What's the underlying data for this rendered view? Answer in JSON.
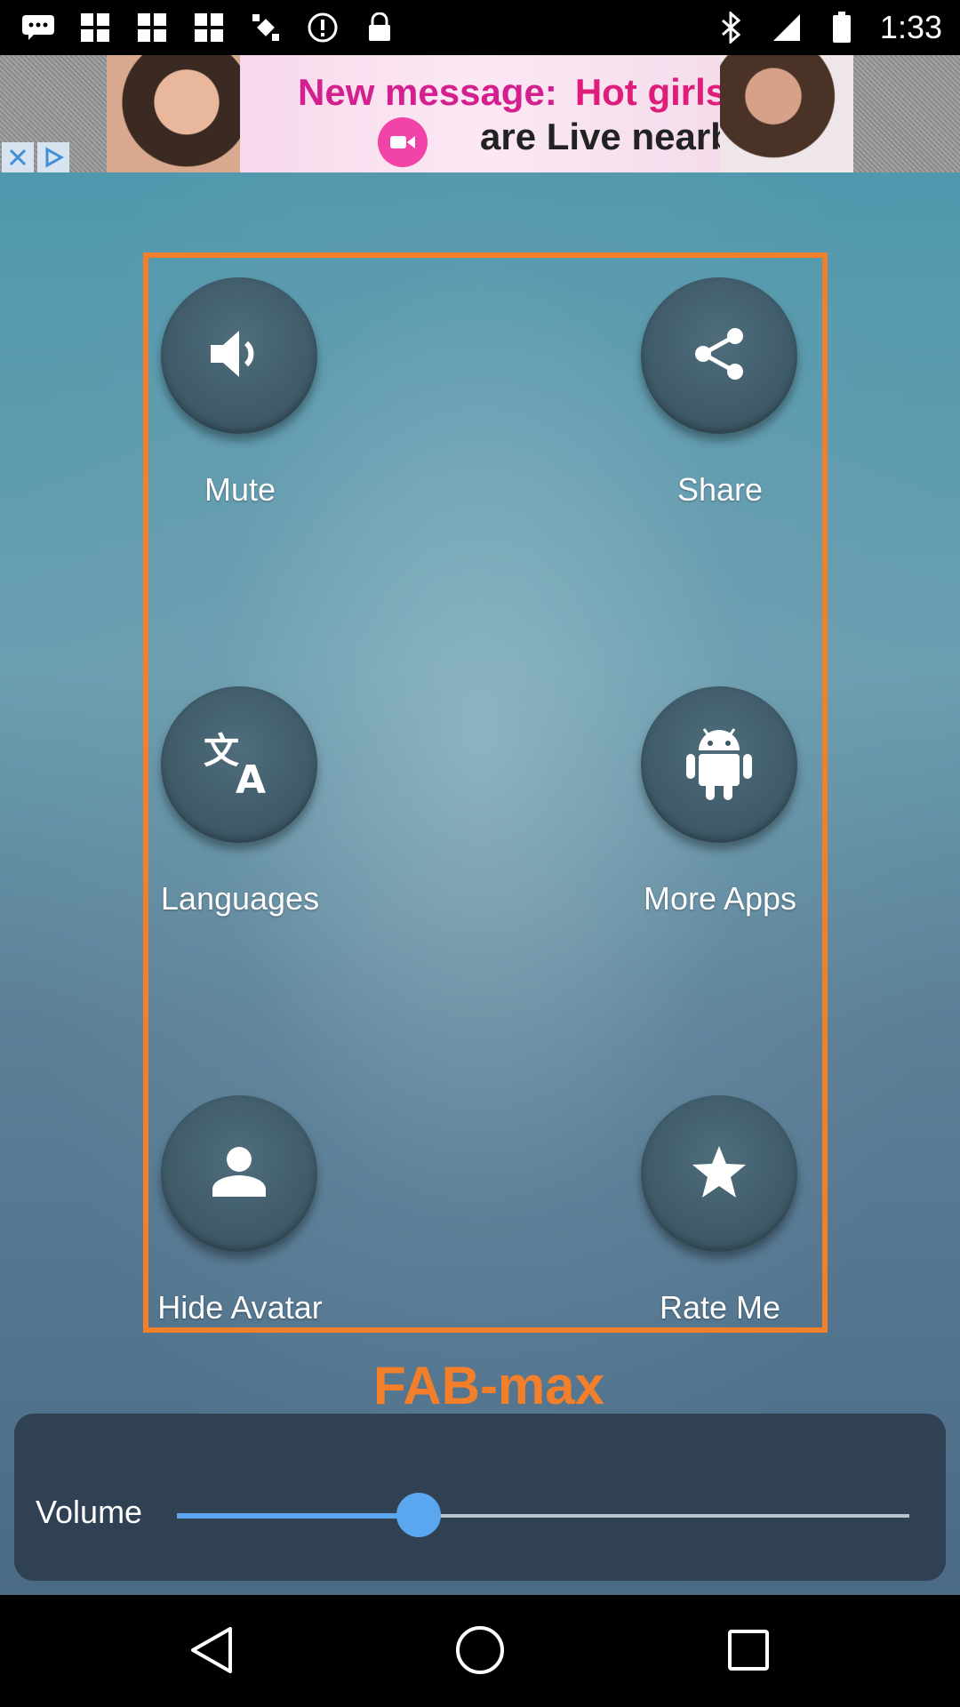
{
  "status_bar": {
    "time": "1:33",
    "left_icons": [
      "chat-icon",
      "grid-icon",
      "grid-icon",
      "grid-icon",
      "satellite-icon",
      "alert-icon",
      "lock-icon"
    ],
    "right_icons": [
      "bluetooth-icon",
      "signal-icon",
      "battery-icon"
    ]
  },
  "ad": {
    "line1_a": "New message:",
    "line1_b": "Hot girls",
    "line2": "are Live nearby"
  },
  "menu": {
    "items": [
      {
        "label": "Mute",
        "icon": "volume-icon"
      },
      {
        "label": "Share",
        "icon": "share-icon"
      },
      {
        "label": "Languages",
        "icon": "translate-icon"
      },
      {
        "label": "More Apps",
        "icon": "android-icon"
      },
      {
        "label": "Hide Avatar",
        "icon": "person-icon"
      },
      {
        "label": "Rate Me",
        "icon": "star-icon"
      }
    ],
    "frame_color": "#f47f2b"
  },
  "brand": {
    "title": "FAB-max"
  },
  "volume": {
    "label": "Volume",
    "level": 0.33,
    "accent": "#5aa7f0"
  },
  "nav": {
    "icons": [
      "back-icon",
      "home-icon",
      "recents-icon"
    ]
  }
}
